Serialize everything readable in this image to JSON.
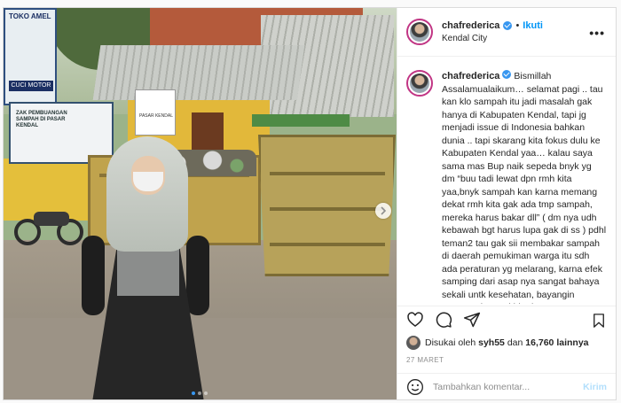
{
  "post": {
    "username": "chafrederica",
    "follow_label": "Ikuti",
    "separator": "•",
    "location": "Kendal City",
    "more_icon": "•••",
    "caption": "Bismillah\nAssalamualaikum… selamat pagi .. tau kan klo sampah itu jadi masalah gak hanya di Kabupaten Kendal, tapi jg menjadi issue di Indonesia bahkan dunia .. tapi skarang kita fokus dulu ke Kabupaten Kendal yaa… kalau saya sama mas Bup naik sepeda bnyk yg dm “buu tadi lewat dpn rmh kita yaa,bnyk sampah kan karna memang dekat rmh kita gak ada tmp sampah, mereka harus bakar dll” ( dm nya udh kebawah bgt harus lupa gak di ss ) pdhl teman2 tau gak sii membakar sampah di daerah pemukiman warga itu sdh ada peraturan yg melarang, karna efek samping dari asap nya sangat bahaya sekali untk kesehatan, bayangin tetangga kanan kiri ada",
    "likes": {
      "prefix": "Disukai oleh",
      "user": "syh55",
      "middle": "dan",
      "count": "16,760 lainnya"
    },
    "date": "27 MARET",
    "comment_placeholder": "Tambahkan komentar...",
    "send_label": "Kirim"
  },
  "photo": {
    "sign_toko_title": "TOKO AMEL",
    "sign_toko_bar": "CUCI MOTOR",
    "sign_dlh": "ZAK PEMBUANGAN SAMPAH DI PASAR KENDAL",
    "sign_pasar": "PASAR KENDAL",
    "carousel_dots": 3,
    "active_dot": 0
  },
  "colors": {
    "accent": "#0095f6",
    "verified": "#3897f0",
    "muted": "#8e8e8e"
  }
}
